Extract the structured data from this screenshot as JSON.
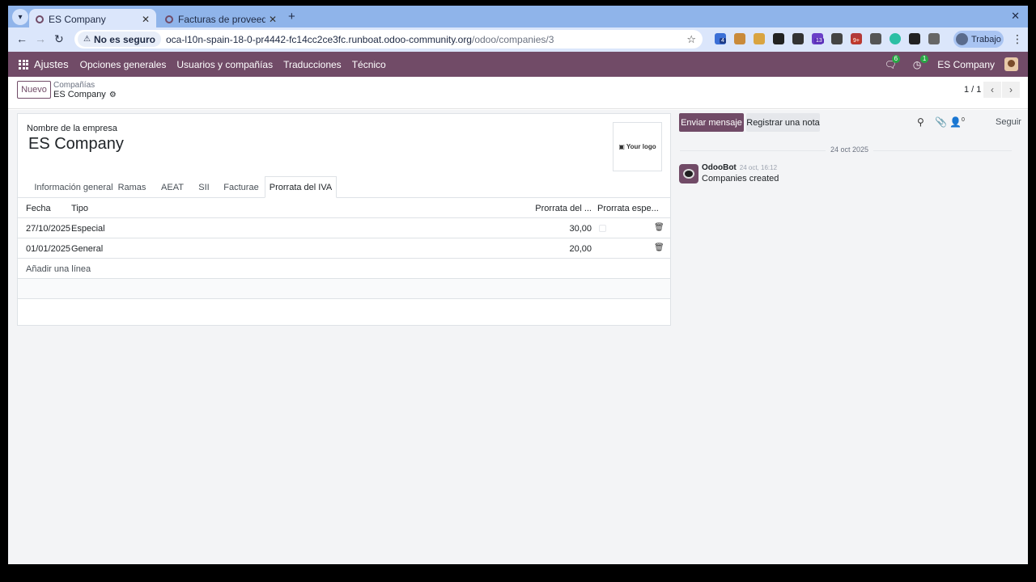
{
  "browser": {
    "tabs": [
      {
        "title": "ES Company",
        "active": true
      },
      {
        "title": "Facturas de proveedor",
        "active": false
      }
    ],
    "security_label": "No es seguro",
    "url_host": "oca-l10n-spain-18-0-pr4442-fc14cc2ce3fc.runboat.odoo-community.org",
    "url_path": "/odoo/companies/3",
    "profile_label": "Trabajo",
    "ext_badges": {
      "ext1": "4",
      "ext2": "13",
      "ext3": "9+"
    }
  },
  "navbar": {
    "app_name": "Ajustes",
    "menu": [
      "Opciones generales",
      "Usuarios y compañías",
      "Traducciones",
      "Técnico"
    ],
    "messages_count": "6",
    "activities_count": "1",
    "company": "ES Company"
  },
  "control": {
    "new_label": "Nuevo",
    "breadcrumb_parent": "Compañías",
    "breadcrumb_current": "ES Company",
    "pager": "1 / 1"
  },
  "form": {
    "company_label": "Nombre de la empresa",
    "company_name": "ES Company",
    "logo_text": "Your logo",
    "tabs": [
      "Información general",
      "Ramas",
      "AEAT",
      "SII",
      "Facturae",
      "Prorrata del IVA"
    ],
    "active_tab": "Prorrata del IVA",
    "columns": {
      "fecha": "Fecha",
      "tipo": "Tipo",
      "prorrata": "Prorrata del ...",
      "especial": "Prorrata espe..."
    },
    "rows": [
      {
        "fecha": "27/10/2025",
        "tipo": "Especial",
        "prorrata": "30,00"
      },
      {
        "fecha": "01/01/2025",
        "tipo": "General",
        "prorrata": "20,00"
      }
    ],
    "add_line": "Añadir una línea"
  },
  "chatter": {
    "send_label": "Enviar mensaje",
    "note_label": "Registrar una nota",
    "followers_count": "0",
    "follow_label": "Seguir",
    "date_separator": "24 oct 2025",
    "message": {
      "author": "OdooBot",
      "time": "24 oct, 16:12",
      "body": "Companies created"
    }
  }
}
